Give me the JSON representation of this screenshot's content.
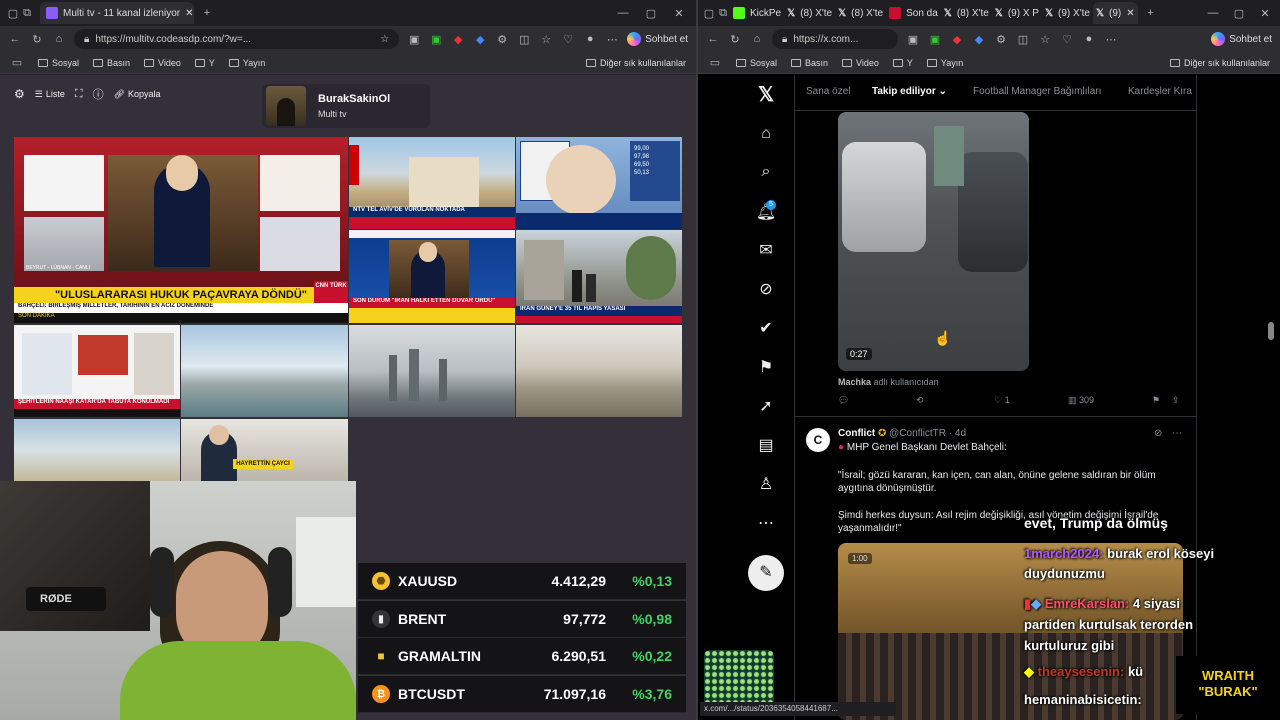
{
  "left_browser": {
    "tab_title": "Multi tv - 11 kanal izleniyor",
    "url": "https://multitv.codeasdp.com/?w=...",
    "bookmarks": [
      "Sosyal",
      "Basın",
      "Video",
      "Y",
      "Yayın"
    ],
    "other_bookmarks": "Diğer sık kullanılanlar",
    "copilot": "Sohbet et"
  },
  "multitv": {
    "list_label": "Liste",
    "copy_label": "Kopyala",
    "profile_name": "BurakSakinOl",
    "profile_sub": "Multi tv"
  },
  "tv": {
    "main_banner": "\"ULUSLARARASI HUKUK PAÇAVRAYA DÖNDÜ\"",
    "main_sub": "BAHÇELİ: BİRLEŞMİŞ MİLLETLER, TARİHİNİN EN ACİZ DÖNEMİNDE",
    "son_dakika": "SON DAKİKA",
    "canli": "CANLI",
    "cnn": "CNN TÜRK",
    "ntv_caption": "NTV TEL AVİV'DE VURULAN NOKTADA",
    "son_durum": "SON DURUM",
    "iran_caption": "\"İRAN HALKI ETTEN DUVAR ÖRDÜ\"",
    "iran_guney": "İRAN GÜNEY'E 35 TIL HAPİS YASASI",
    "sehit_caption": "ŞEHİTLERİN NAAŞI KATAR'DA TABUTA KONULMADI",
    "person_caption": "HAYRETTİN ÇAYCI",
    "beyrut": "BEYRUT - LÜBNAN - CANLI",
    "prices": [
      "99,00",
      "97,98",
      "69,50",
      "50,13"
    ]
  },
  "tickers": [
    {
      "symbol": "XAUUSD",
      "price": "4.412,29",
      "change": "%0,13",
      "icon": "gold-coin-icon",
      "color": "#f2c230"
    },
    {
      "symbol": "BRENT",
      "price": "97,772",
      "change": "%0,98",
      "icon": "oil-barrel-icon",
      "color": "#e8e8e8"
    },
    {
      "symbol": "GRAMALTIN",
      "price": "6.290,51",
      "change": "%0,22",
      "icon": "gold-bar-icon",
      "color": "#f2c230"
    },
    {
      "symbol": "BTCUSDT",
      "price": "71.097,16",
      "change": "%3,76",
      "icon": "bitcoin-icon",
      "color": "#f7931a"
    }
  ],
  "right_browser": {
    "tabs": [
      "KickPe",
      "(8) X'te",
      "(8) X'te",
      "Son da",
      "(8) X'te",
      "(9) X P",
      "(9) X'te",
      "(9)"
    ],
    "url": "https://x.com...",
    "bookmarks": [
      "Sosyal",
      "Basın",
      "Video",
      "Y",
      "Yayın"
    ],
    "other_bookmarks": "Diğer sık kullanılanlar",
    "copilot": "Sohbet et",
    "status_url": "x.com/.../status/2036354058441687..."
  },
  "x": {
    "tabs": [
      "Sana özel",
      "Takip ediliyor",
      "Football Manager Bağımlıları",
      "Kardeşler Kıra"
    ],
    "notification_count": "5",
    "video_duration": "0:27",
    "machka_user": "Machka",
    "machka_suffix": "adlı kullanıcıdan",
    "like_count": "1",
    "view_count": "309",
    "post": {
      "author": "Conflict",
      "handle": "@ConflictTR · 4d",
      "line1": "MHP Genel Başkanı Devlet Bahçeli:",
      "quote1": "\"İsrail; gözü kararan, kan içen, can alan, önüne gelene saldıran bir ölüm aygıtına dönüşmüştür.",
      "quote2": "Şimdi herkes duysun: Asıl rejim değişikliği, asıl yönetim değişimi İsrail'de yaşanmalıdır!\"",
      "video_badge": "1:00"
    }
  },
  "chat": [
    {
      "user": "",
      "text": "evet, Trump da ölmüş"
    },
    {
      "user": "1march2024:",
      "text": "burak erol köseyi duydunuzmu"
    },
    {
      "user": "EmreKarslan:",
      "text": "4 siyasi partiden kurtulsak terorden kurtuluruz gibi"
    },
    {
      "user": "theaysesenin:",
      "text": "kü"
    },
    {
      "user": "",
      "text": "hemaninabisicetin:"
    }
  ],
  "brand": {
    "line1": "WRAITH",
    "line2": "\"BURAK\""
  },
  "webcam": {
    "mic_brand": "RØDE"
  }
}
